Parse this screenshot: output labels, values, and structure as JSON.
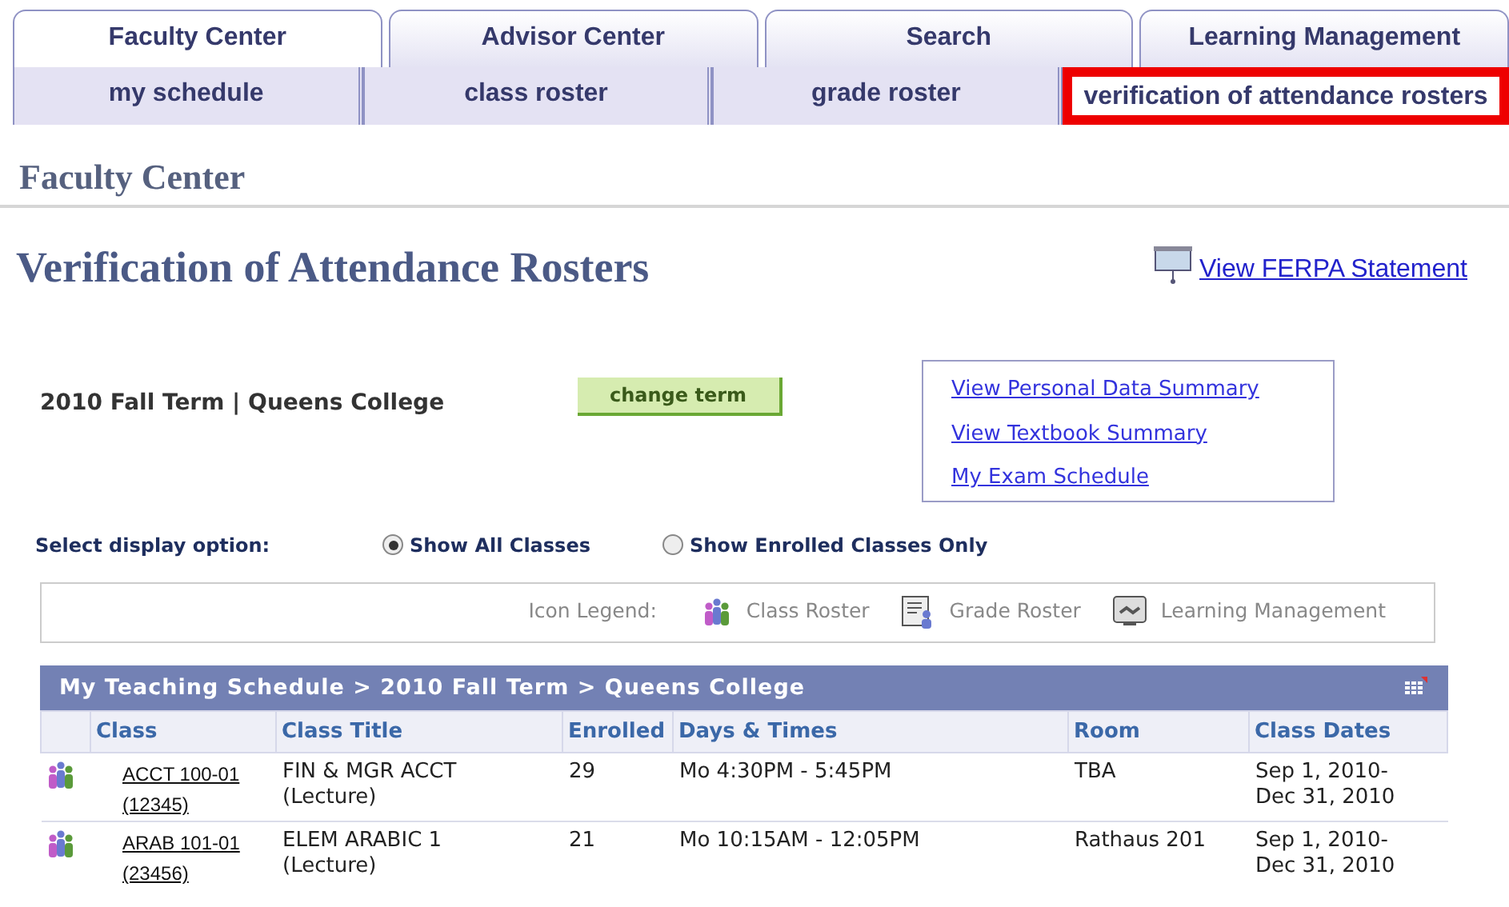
{
  "main_tabs": [
    {
      "label": "Faculty Center",
      "selected": true
    },
    {
      "label": "Advisor Center",
      "selected": false
    },
    {
      "label": "Search",
      "selected": false
    },
    {
      "label": "Learning Management",
      "selected": false
    }
  ],
  "sub_tabs": [
    {
      "label": "my schedule",
      "selected": false,
      "highlighted": false
    },
    {
      "label": "class roster",
      "selected": false,
      "highlighted": false
    },
    {
      "label": "grade roster",
      "selected": false,
      "highlighted": false
    },
    {
      "label": "verification of attendance rosters",
      "selected": true,
      "highlighted": true
    }
  ],
  "section_title": "Faculty Center",
  "page_title": "Verification of Attendance Rosters",
  "ferpa_link": "View FERPA Statement",
  "term": "2010 Fall Term | Queens College",
  "change_term_button": "change term",
  "links": [
    "View Personal Data Summary",
    "View Textbook Summary",
    "My Exam Schedule"
  ],
  "display_option": {
    "label": "Select display option:",
    "options": [
      {
        "label": "Show All Classes",
        "selected": true
      },
      {
        "label": "Show Enrolled Classes Only",
        "selected": false
      }
    ]
  },
  "icon_legend": {
    "label": "Icon Legend:",
    "items": [
      {
        "kind": "class-roster",
        "label": "Class Roster"
      },
      {
        "kind": "grade-roster",
        "label": "Grade Roster"
      },
      {
        "kind": "learning-management",
        "label": "Learning Management"
      }
    ]
  },
  "schedule": {
    "title": "My Teaching Schedule > 2010 Fall Term > Queens College",
    "columns": [
      "Class",
      "Class Title",
      "Enrolled",
      "Days & Times",
      "Room",
      "Class Dates"
    ],
    "rows": [
      {
        "class": "ACCT 100-01",
        "class_number": "(12345)",
        "title": "FIN & MGR ACCT",
        "component": "(Lecture)",
        "enrolled": "29",
        "days_times": "Mo 4:30PM - 5:45PM",
        "room": "TBA",
        "dates_start": "Sep 1, 2010-",
        "dates_end": "Dec 31, 2010"
      },
      {
        "class": "ARAB 101-01",
        "class_number": "(23456)",
        "title": "ELEM ARABIC 1",
        "component": "(Lecture)",
        "enrolled": "21",
        "days_times": "Mo 10:15AM - 12:05PM",
        "room": "Rathaus 201",
        "dates_start": "Sep 1, 2010-",
        "dates_end": "Dec 31, 2010"
      }
    ]
  }
}
